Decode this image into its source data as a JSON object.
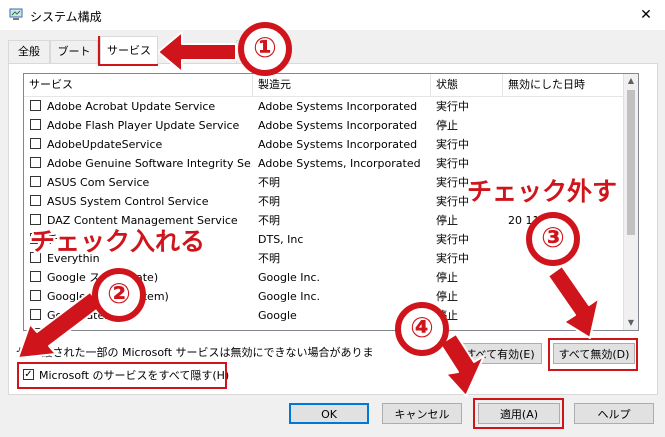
{
  "window": {
    "title": "システム構成",
    "close_glyph": "✕"
  },
  "tabs": [
    {
      "label": "全般"
    },
    {
      "label": "ブート"
    },
    {
      "label": "サービス"
    },
    {
      "label": "ール"
    }
  ],
  "table": {
    "headers": [
      "サービス",
      "製造元",
      "状態",
      "無効にした日時"
    ],
    "rows": [
      {
        "name": "Adobe Acrobat Update Service",
        "maker": "Adobe Systems Incorporated",
        "status": "実行中",
        "date": ""
      },
      {
        "name": "Adobe Flash Player Update Service",
        "maker": "Adobe Systems Incorporated",
        "status": "停止",
        "date": ""
      },
      {
        "name": "AdobeUpdateService",
        "maker": "Adobe Systems Incorporated",
        "status": "実行中",
        "date": ""
      },
      {
        "name": "Adobe Genuine Software Integrity Se...",
        "maker": "Adobe Systems, Incorporated",
        "status": "実行中",
        "date": ""
      },
      {
        "name": "ASUS Com Service",
        "maker": "不明",
        "status": "実行中",
        "date": ""
      },
      {
        "name": "ASUS System Control Service",
        "maker": "不明",
        "status": "実行中",
        "date": ""
      },
      {
        "name": "DAZ Content Management Service",
        "maker": "不明",
        "status": "停止",
        "date": "20 11:28"
      },
      {
        "name": "チ",
        "maker": "DTS, Inc",
        "status": "実行中",
        "date": ""
      },
      {
        "name": "Everythin",
        "maker": "不明",
        "status": "実行中",
        "date": ""
      },
      {
        "name": "Google ス (gupdate)",
        "maker": "Google Inc.",
        "status": "停止",
        "date": ""
      },
      {
        "name": "Google ス (gupdatem)",
        "maker": "Google Inc.",
        "status": "停止",
        "date": ""
      },
      {
        "name": "Goo pdater",
        "maker": "Google",
        "status": "停止",
        "date": ""
      },
      {
        "name": "",
        "maker": "",
        "status": "",
        "date": ""
      }
    ]
  },
  "note_text": "セキ 護された一部の Microsoft サービスは無効にできない場合がありま",
  "hide_ms": {
    "label": "Microsoft のサービスをすべて隠す(H)",
    "checked_glyph": "✓"
  },
  "buttons": {
    "enable_all": "すべて有効(E)",
    "disable_all": "すべて無効(D)",
    "ok": "OK",
    "cancel": "キャンセル",
    "apply": "適用(A)",
    "help": "ヘルプ"
  },
  "annotations": {
    "step1": "①",
    "step2": "②",
    "step3": "③",
    "step4": "④",
    "callout_check_on": "チェック入れる",
    "callout_check_off": "チェック外す"
  },
  "colors": {
    "annotation_red": "#d0141b",
    "focus_blue": "#0078d7"
  }
}
